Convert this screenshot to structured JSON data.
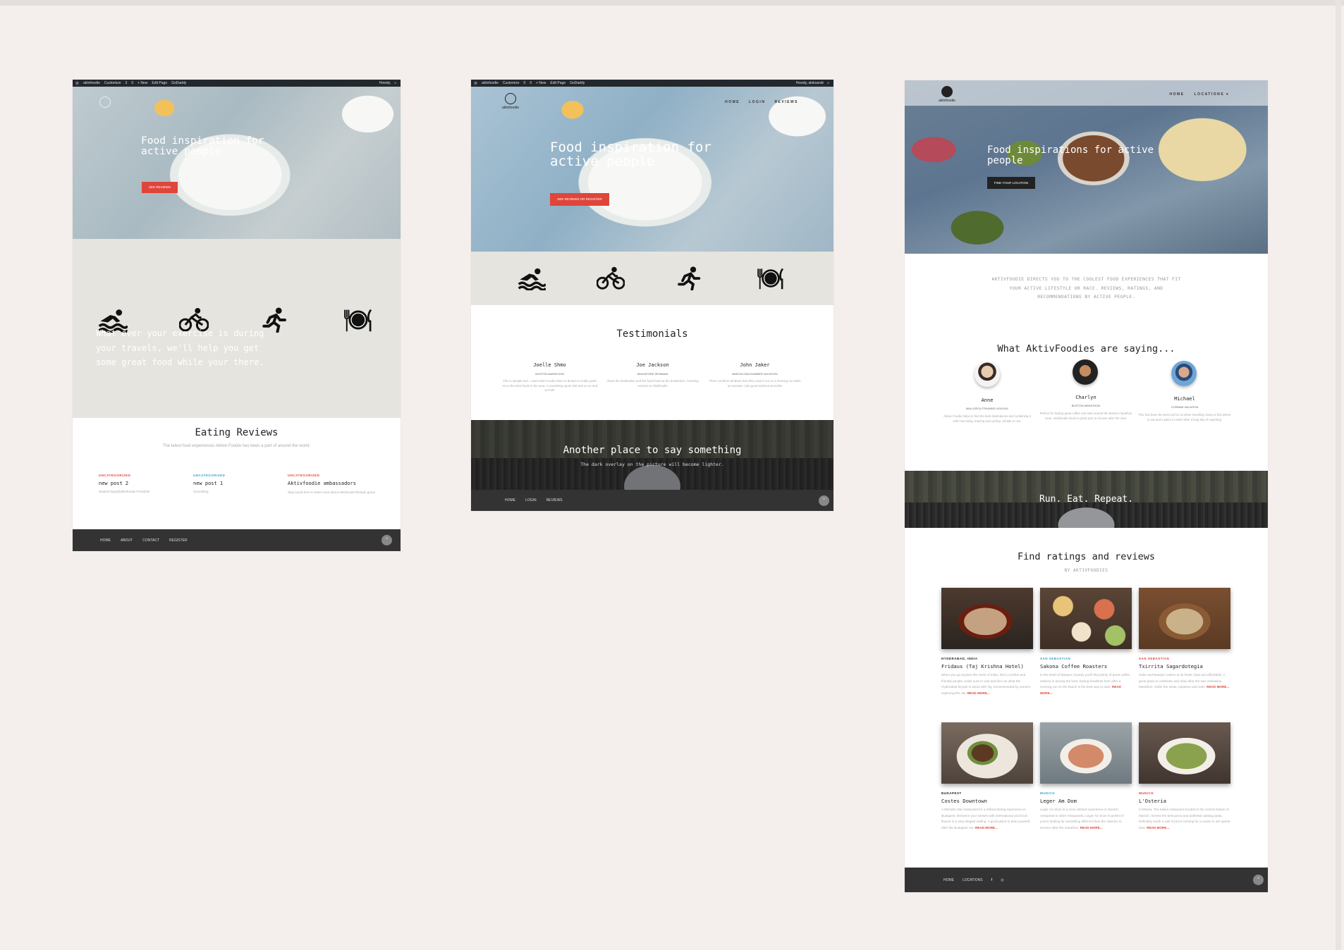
{
  "frame1": {
    "wpbar": {
      "items": [
        "aktivfoodie",
        "Customize",
        "3",
        "0",
        "+ New",
        "Edit Page",
        "GoDaddy"
      ],
      "howdy": "Howdy,"
    },
    "hero_title": "Food inspiration for active people",
    "hero_button": "SEE REVIEWS",
    "tagline": "What ever your exercise is during your travels, we'll help you get some great food while your there.",
    "section_title": "Eating Reviews",
    "section_subtitle": "The latest food experiences Aktive Foodie has been a part of around the world.",
    "posts": [
      {
        "category": "UNCATEGORIZED",
        "title": "new post 2",
        "excerpt": "whatsit blogs@aktivfoodie Freedrink"
      },
      {
        "category": "UNCATEGORIZED",
        "title": "new post 1",
        "excerpt": "Something"
      },
      {
        "category": "UNCATEGORIZED",
        "title": "Aktivfoodie ambassadors",
        "excerpt": "Stay tuned here to learn more about Aktivfoodie lifestyle gurus"
      }
    ],
    "footer_links": [
      "HOME",
      "ABOUT",
      "CONTACT",
      "REGISTER"
    ]
  },
  "frame2": {
    "wpbar": {
      "items": [
        "aktivfoodie",
        "Customize",
        "0",
        "0",
        "+ New",
        "Edit Page",
        "GoDaddy"
      ],
      "howdy": "Howdy, aleksandr"
    },
    "logo_text": "aktivfoodie",
    "nav": [
      "HOME",
      "LOGIN",
      "REVIEWS"
    ],
    "hero_title": "Food inspiration for active people",
    "hero_button": "SEE REVIEWS OR REGISTER",
    "testimonials_title": "Testimonials",
    "testimonials": [
      {
        "name": "Joelle Shmo",
        "role": "BOSTON MARATHON",
        "quote": "This is sample text. I used Aktiv Foodie when in Boston to really guide me to the best foods in the area. A something quote that and so on and so forth"
      },
      {
        "name": "Joe Jackson",
        "role": "SINGAPORE IRONMAN",
        "quote": "About the destination and the food found at the destination. Amazing reviews on Aktivfoodie"
      },
      {
        "name": "John Jaker",
        "role": "BARCELONA SUMMER VACATION",
        "quote": "There could be all about how they used it out on a morning run while on vacation. Like good workout smoothie"
      }
    ],
    "banner_title": "Another place to say something",
    "banner_subtitle": "The dark overlay on the picture will become lighter.",
    "footer_links": [
      "HOME",
      "LOGIN",
      "REVIEWS"
    ]
  },
  "frame3": {
    "logo_text": "aktivfoodie",
    "nav": [
      "HOME",
      "LOCATIONS ▾"
    ],
    "hero_title": "Food inspirations for active people",
    "hero_button": "FIND YOUR LOCATION",
    "intro": "AKTIVFOODIE DIRECTS YOU TO THE COOLEST FOOD EXPERIENCES THAT FIT YOUR ACTIVE LIFESTYLE OR RACE. REVIEWS, RATINGS, AND RECOMMENDATIONS BY ACTIVE PEOPLE.",
    "saying_title": "What AktivFoodies are saying...",
    "people": [
      {
        "name": "Anne",
        "role": "MALLORCA TRAINING HOLIDAY",
        "quote": "Aktive Foodie helps to find the best destinations and combining it with exercising, training and cycling. Simple to use."
      },
      {
        "name": "Charlyn",
        "role": "BOSTON MARATHON",
        "quote": "Perfect for finding great coffee and eats around the Boston marathon route. Aktivfoodie found a great spot to recover after the race."
      },
      {
        "name": "Michael",
        "role": "CORMAN VACATION",
        "quote": "This has been the best tool for us when travelling. Easy to find where to eat and a place to refuel after a long day of exploring."
      }
    ],
    "run_banner": "Run. Eat. Repeat.",
    "find_title": "Find ratings and reviews",
    "find_subtitle": "BY AKTIVFOODIES",
    "restaurants": [
      {
        "location": "HYDERABAD, INDIA",
        "name": "Fridaus (Taj Krishna Hotel)",
        "desc": "When you go explore the rivers of India, find a comfort and friendly people, make sure to visit and find out what the Hyderabad biryani is about with Taj, recommended by runners exploring the city.",
        "more": "READ MORE..."
      },
      {
        "location": "SAN SEBASTIAN",
        "name": "Sakona Coffee Roasters",
        "desc": "In the heart of Basque Country you'll find plenty of great coffee, Sakona is among the best, having breakfast here after a morning run on the beach is the best way to start.",
        "more": "READ MORE..."
      },
      {
        "location": "SAN SEBASTIAN",
        "name": "Txirrita Sagardotegia",
        "desc": "Cider and Basque cuisine at its finest, best and affordable. A great place to celebrate and relax after the San Sebastian Marathon. Order the steak, potatoes and cider.",
        "more": "READ MORE..."
      },
      {
        "location": "BUDAPEST",
        "name": "Costes Downtown",
        "desc": "A Michelin star restaurant for a refined dining experience in Budapest. Enhance your senses with international and local flavors in a very elegant setting. A good place to treat yourself after the Budapest run.",
        "more": "READ MORE..."
      },
      {
        "location": "MUNICH",
        "name": "Leger Am Dom",
        "desc": "Leger Am Dom is a more refined experience in Munich, compared to other restaurants. Leger Am Dom is perfect if you're looking for something different than the classics to recover after the marathon.",
        "more": "READ MORE..."
      },
      {
        "location": "MUNICH",
        "name": "L'Osteria",
        "desc": "L'Osteria. The Italian restaurant located in the central station of Munich. Serves the best pizza and authentic tasting pasta. Definitely worth a visit if you're running for a cause or are sports fans.",
        "more": "READ MORE..."
      }
    ],
    "footer_links": [
      "HOME",
      "LOCATIONS"
    ]
  },
  "colors": {
    "accent_red": "#e0453a",
    "accent_blue": "#3aa0c8",
    "footer": "#333333",
    "background": "#f4eeed"
  },
  "icons": [
    "swimmer-icon",
    "bicycle-icon",
    "runner-icon",
    "plate-icon"
  ]
}
